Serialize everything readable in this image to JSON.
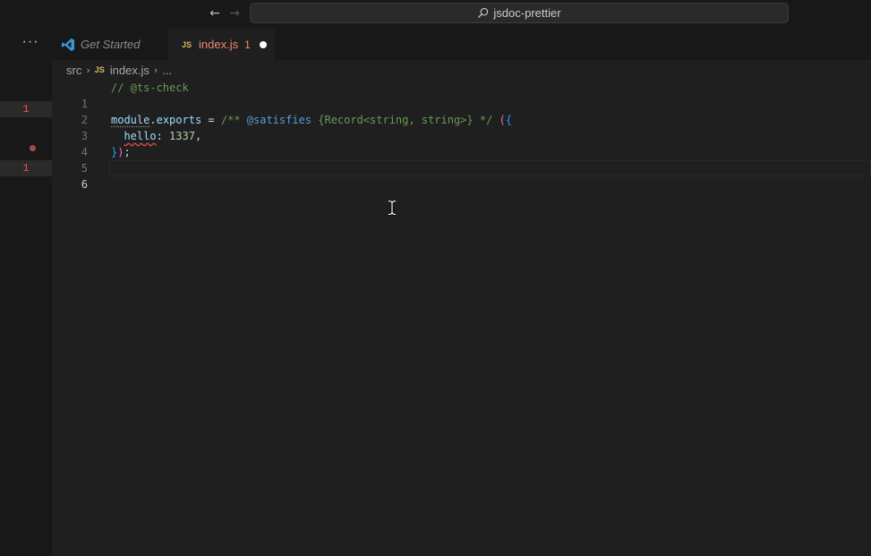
{
  "titlebar": {
    "back_icon": "arrow-left-icon",
    "forward_icon": "arrow-right-icon",
    "search_icon": "search-icon",
    "command_center_label": "jsdoc-prettier"
  },
  "activity": {
    "more_label": "···",
    "overview_markers": [
      "1",
      "1"
    ]
  },
  "tabs": [
    {
      "label": "Get Started",
      "icon": "vscode-icon"
    },
    {
      "label": "index.js",
      "icon_text": "JS",
      "problems": "1",
      "dirty": true
    }
  ],
  "breadcrumb": {
    "folder": "src",
    "file_icon_text": "JS",
    "file": "index.js",
    "more": "..."
  },
  "editor": {
    "active_line": "6",
    "lines": [
      {
        "number": "1",
        "comment": "// @ts-check"
      },
      {
        "number": "2"
      },
      {
        "number": "3",
        "module": "module",
        "dot": ".",
        "exports": "exports",
        "eq": " = ",
        "jsdoc_open": "/** ",
        "tag": "@satisfies",
        "type": " {Record<string, string>} ",
        "jsdoc_close": "*/",
        "paren": " (",
        "brace": "{"
      },
      {
        "number": "4",
        "indent": "  ",
        "key": "hello",
        "colon": ": ",
        "value": "1337",
        "comma": ","
      },
      {
        "number": "5",
        "brace": "}",
        "paren": ")",
        "semi": ";"
      },
      {
        "number": "6"
      }
    ]
  },
  "colors": {
    "error": "#f48771",
    "comment": "#6a9955",
    "keyword_tag": "#569cd6",
    "editor_bg": "#1f1f1f"
  }
}
